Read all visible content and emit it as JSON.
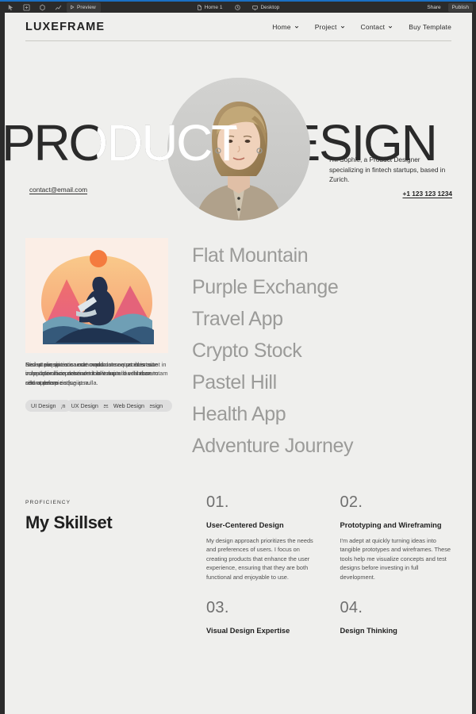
{
  "builder": {
    "toolbar_left_icons": [
      "cursor-icon",
      "add-page-icon",
      "assets-icon",
      "analytics-icon"
    ],
    "preview_label": "Preview",
    "page_name": "Home 1",
    "breakpoint_label": "Desktop",
    "share_label": "Share",
    "publish_label": "Publish",
    "accent_color": "#1a6fc4",
    "chrome_color": "#2b2b2b"
  },
  "site": {
    "brand": "LUXEFRAME",
    "nav": [
      {
        "label": "Home",
        "has_dropdown": true
      },
      {
        "label": "Project",
        "has_dropdown": true
      },
      {
        "label": "Contact",
        "has_dropdown": true
      },
      {
        "label": "Buy Template",
        "has_dropdown": false
      }
    ],
    "hero": {
      "title": "PRODUCT DESIGN",
      "bio": "I'm Sophie, a Product Designer specializing in fintech startups, based in Zurich.",
      "email": "contact@email.com",
      "phone": "+1 123 123 1234",
      "portrait_alt": "portrait-photo"
    },
    "projects": {
      "card_descriptions": [
        "Nisi ut aliquip ex ea commodo consequat duis aute irure dolor in reprehenderit in voluptate velit esse cillum dolore eu fugiat nulla.",
        "Excepteur sint occaecat cupidatat non proident sunt in culpa qui officia deserunt mollit anim id est laborum sed ut perspiciatis.",
        "Sed ut perspiciatis unde omnis iste natus error sit voluptatem accusantium doloremque laudantium totam rem aperiam eaque ipsa."
      ],
      "tag_groups": [
        [
          "Digital Design",
          "Product Design",
          "Web Design"
        ],
        [
          "Brand Design",
          "Mobile Design",
          "Web Design"
        ],
        [
          "UI Design",
          "UX Design",
          "Web Design"
        ]
      ],
      "list": [
        "Flat Mountain",
        "Purple Exchange",
        "Travel App",
        "Crypto Stock",
        "Pastel Hill",
        "Health App",
        "Adventure Journey"
      ]
    },
    "skillset": {
      "eyebrow": "PROFICIENCY",
      "title": "My Skillset",
      "items": [
        {
          "number": "01.",
          "name": "User-Centered Design",
          "description": "My design approach prioritizes the needs and preferences of users. I focus on creating products that enhance the user experience, ensuring that they are both functional and enjoyable to use."
        },
        {
          "number": "02.",
          "name": "Prototyping and Wireframing",
          "description": "I'm adept at quickly turning ideas into tangible prototypes and wireframes. These tools help me visualize concepts and test designs before investing in full development."
        },
        {
          "number": "03.",
          "name": "Visual Design Expertise",
          "description": ""
        },
        {
          "number": "04.",
          "name": "Design Thinking",
          "description": ""
        }
      ]
    }
  }
}
